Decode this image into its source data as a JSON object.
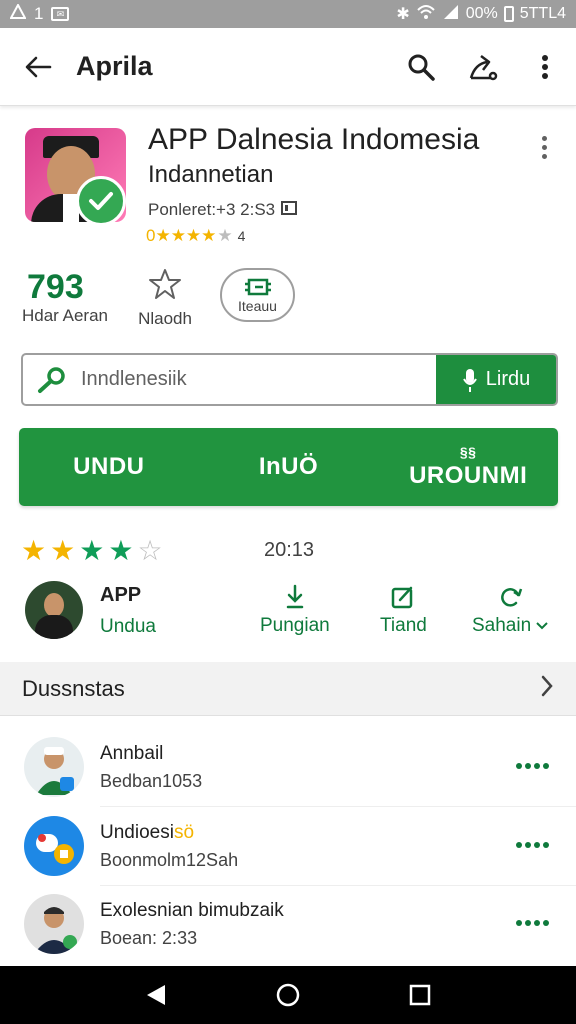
{
  "status_bar": {
    "left": "1",
    "right_text": "00%",
    "time": "5TTL4"
  },
  "app_bar": {
    "title": "Aprila"
  },
  "app": {
    "name": "APP Dalnesia Indomesia",
    "developer": "Indannetian",
    "meta": "Ponleret:+3 2:S3",
    "stars_text": "0★★★★",
    "stars_tail": "4"
  },
  "stats": {
    "count": "793",
    "count_label": "Hdar Aeran",
    "rate_label": "Nlaodh",
    "badge_label": "Iteauu"
  },
  "search": {
    "placeholder": "Inndlenesiik",
    "button_label": "Lirdu"
  },
  "actions": {
    "btn1": "UNDU",
    "btn2": "InUÖ",
    "btn3": "UROUNMI",
    "btn3_top": "§§"
  },
  "rating": {
    "year": "20:13",
    "value": 4,
    "max": 5
  },
  "developer_row": {
    "title": "APP",
    "subtitle": "Undua",
    "actions": [
      {
        "label": "Pungian",
        "icon": "download-icon"
      },
      {
        "label": "Tiand",
        "icon": "edit-icon"
      },
      {
        "label": "Sahain",
        "icon": "sync-icon"
      }
    ]
  },
  "section": {
    "title": "Dussnstas"
  },
  "list": [
    {
      "title": "Annbail",
      "subtitle": "Bedban1053"
    },
    {
      "title": "Undioesi",
      "title_badge": "sö",
      "subtitle": "Boonmolm12Sah"
    },
    {
      "title": "Exolesnian bimubzaik",
      "subtitle": "Boean: 2:33"
    }
  ],
  "colors": {
    "brand_green": "#21943f",
    "dark_green": "#0f7a3c",
    "star_yellow": "#f4b400",
    "status_bar": "#9e9e9e"
  }
}
